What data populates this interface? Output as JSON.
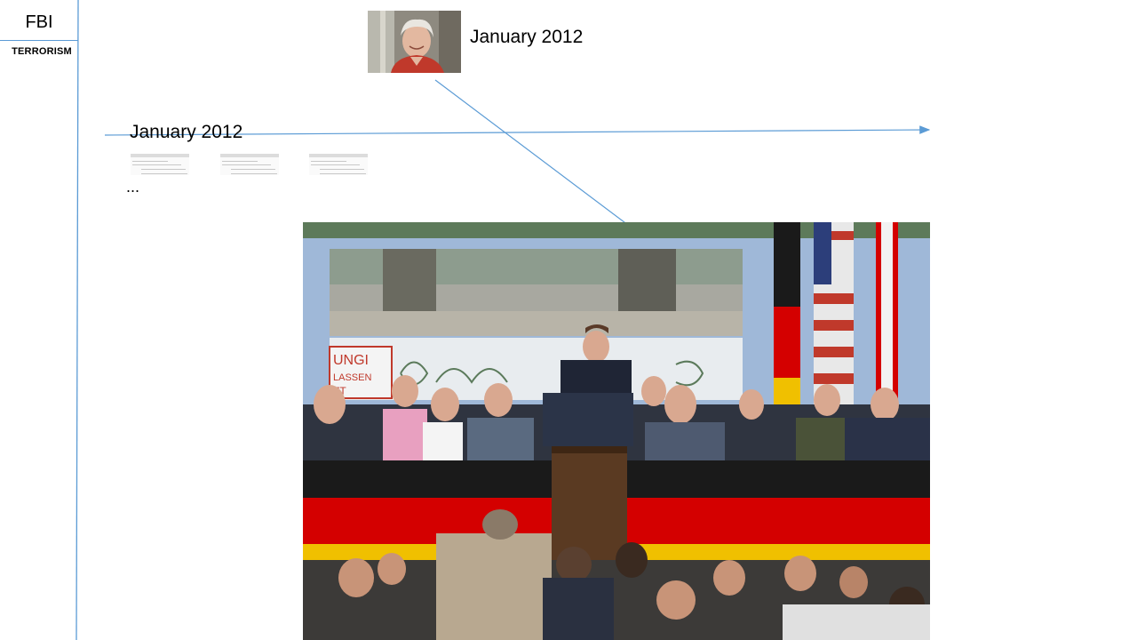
{
  "sidebar": {
    "title": "FBI",
    "subtitle": "TERRORISM"
  },
  "header": {
    "portrait_date": "January 2012"
  },
  "timeline": {
    "date_label": "January 2012",
    "ellipsis": "...",
    "document_thumbnails": [
      "document-thumbnail",
      "document-thumbnail",
      "document-thumbnail"
    ]
  },
  "colors": {
    "accent_line": "#5b9bd5",
    "flag_black": "#1a1a1a",
    "flag_red": "#d40000",
    "flag_gold": "#f0c000"
  }
}
